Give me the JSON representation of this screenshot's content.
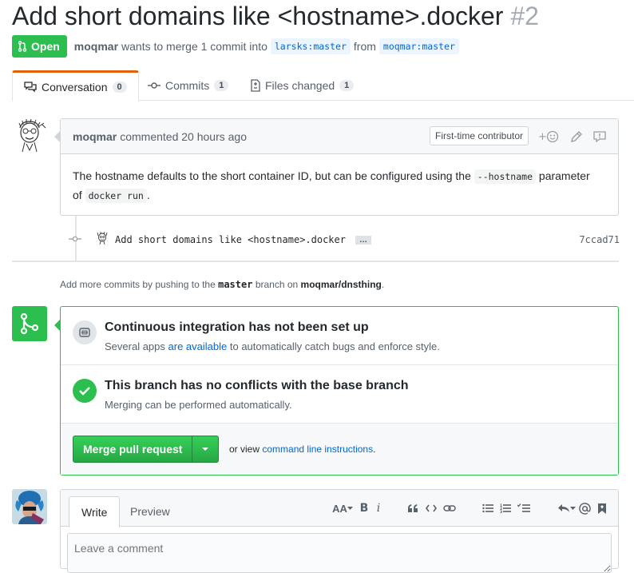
{
  "pr": {
    "title": "Add short domains like <hostname>.docker",
    "number": "#2",
    "state": "Open",
    "author": "moqmar",
    "meta_text": "wants to merge 1 commit into",
    "base_ref": "larsks:master",
    "from_text": "from",
    "head_ref": "moqmar:master"
  },
  "tabs": [
    {
      "label": "Conversation",
      "count": "0"
    },
    {
      "label": "Commits",
      "count": "1"
    },
    {
      "label": "Files changed",
      "count": "1"
    }
  ],
  "comment": {
    "author": "moqmar",
    "action": "commented 20 hours ago",
    "badge": "First-time contributor",
    "body_part1": "The hostname defaults to the short container ID, but can be configured using the",
    "code1": "--hostname",
    "body_part2": "parameter",
    "body_part3": "of",
    "code2": "docker run",
    "body_part4": "."
  },
  "commit": {
    "message": "Add short domains like <hostname>.docker",
    "ellipsis": "…",
    "sha": "7ccad71"
  },
  "hint": {
    "pre": "Add more commits by pushing to the",
    "branch": "master",
    "mid": "branch on",
    "repo": "moqmar/dnsthing",
    "end": "."
  },
  "merge": {
    "ci_title": "Continuous integration has not been set up",
    "ci_sub_pre": "Several apps",
    "ci_sub_link": "are available",
    "ci_sub_post": "to automatically catch bugs and enforce style.",
    "conflict_title": "This branch has no conflicts with the base branch",
    "conflict_sub": "Merging can be performed automatically.",
    "button": "Merge pull request",
    "or_view": "or view",
    "cli_link": "command line instructions",
    "cli_end": "."
  },
  "compose": {
    "write_tab": "Write",
    "preview_tab": "Preview",
    "placeholder": "Leave a comment",
    "heading_tool": "AA",
    "bold_tool": "B",
    "italic_tool": "i"
  },
  "colors": {
    "open_green": "#2cbe4e",
    "link_blue": "#0366d6",
    "tab_accent": "#e36209"
  }
}
